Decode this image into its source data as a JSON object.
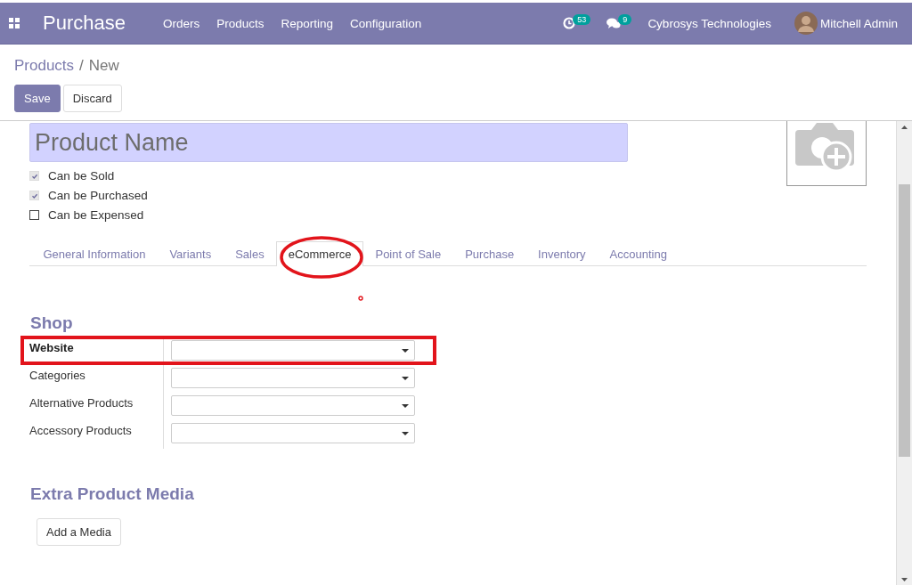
{
  "navbar": {
    "app_title": "Purchase",
    "menu": [
      "Orders",
      "Products",
      "Reporting",
      "Configuration"
    ],
    "activity_count": "53",
    "message_count": "9",
    "company": "Cybrosys Technologies",
    "user": "Mitchell Admin"
  },
  "breadcrumb": {
    "parent": "Products",
    "separator": "/",
    "current": "New"
  },
  "buttons": [
    {
      "label": "Save",
      "kind": "primary"
    },
    {
      "label": "Discard",
      "kind": "secondary"
    }
  ],
  "product_name": {
    "placeholder": "Product Name"
  },
  "checkboxes": [
    {
      "label": "Can be Sold",
      "checked": true
    },
    {
      "label": "Can be Purchased",
      "checked": true
    },
    {
      "label": "Can be Expensed",
      "checked": false
    }
  ],
  "tabs": [
    {
      "label": "General Information",
      "selected": false
    },
    {
      "label": "Variants",
      "selected": false
    },
    {
      "label": "Sales",
      "selected": false
    },
    {
      "label": "eCommerce",
      "selected": true
    },
    {
      "label": "Point of Sale",
      "selected": false
    },
    {
      "label": "Purchase",
      "selected": false
    },
    {
      "label": "Inventory",
      "selected": false
    },
    {
      "label": "Accounting",
      "selected": false
    }
  ],
  "shop": {
    "title": "Shop",
    "fields": [
      {
        "label": "Website",
        "required": true
      },
      {
        "label": "Categories",
        "required": false
      },
      {
        "label": "Alternative Products",
        "required": false
      },
      {
        "label": "Accessory Products",
        "required": false
      }
    ]
  },
  "media": {
    "title": "Extra Product Media",
    "button": "Add a Media"
  }
}
